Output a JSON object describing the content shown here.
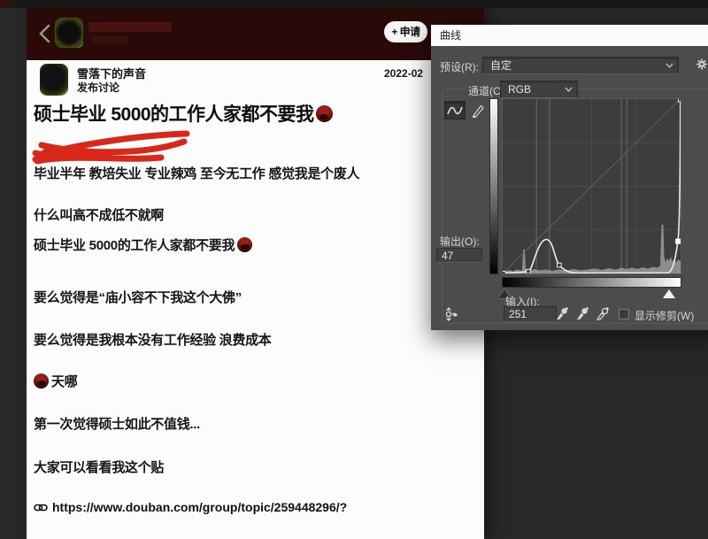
{
  "post": {
    "header": {
      "apply_label": "+ 申请"
    },
    "author": {
      "name": "雪落下的声音",
      "action": "发布讨论",
      "date": "2022-02"
    },
    "title": "硕士毕业 5000的工作人家都不要我",
    "lines": [
      "毕业半年 教培失业 专业辣鸡 至今无工作 感觉我是个废人",
      "什么叫高不成低不就啊",
      "硕士毕业 5000的工作人家都不要我",
      "要么觉得是“庙小容不下我这个大佛”",
      "要么觉得是我根本没有工作经验 浪费成本",
      "天哪",
      "第一次觉得硕士如此不值钱...",
      "大家可以看看我这个贴"
    ],
    "link": "https://www.douban.com/group/topic/259448296/?"
  },
  "dialog": {
    "title": "曲线",
    "preset": {
      "label": "预设(R):",
      "value": "自定"
    },
    "channel": {
      "label": "通道(C):",
      "value": "RGB"
    },
    "output": {
      "label": "输出(O):",
      "value": "47"
    },
    "input": {
      "label": "输入(I):",
      "value": "251"
    },
    "show_clip_label": "显示修剪(W)",
    "curve": {
      "channel": "RGB",
      "points_input_output": [
        [
          0,
          0
        ],
        [
          37,
          3
        ],
        [
          63,
          50
        ],
        [
          81,
          12
        ],
        [
          251,
          47
        ],
        [
          255,
          255
        ]
      ],
      "selected_point": [
        251,
        47
      ]
    }
  },
  "colors": {
    "scribble_red": "#d7281a",
    "post_header_bg": "#2a0909",
    "dialog_bg": "#4c4c4c",
    "curve_line": "#ececec",
    "histogram": "#9b9b9b"
  }
}
